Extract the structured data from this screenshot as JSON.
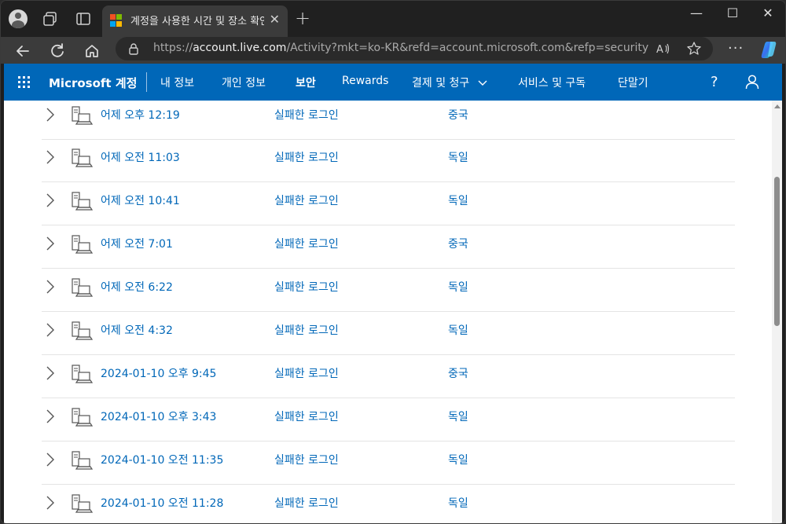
{
  "browser": {
    "tab": {
      "title": "계정을 사용한 시간 및 장소 확인",
      "favicon_colors": [
        "#f25022",
        "#7fba00",
        "#00a4ef",
        "#ffb900"
      ]
    },
    "new_tab_label": "+",
    "close_tab_label": "✕",
    "window_controls": {
      "minimize": "—",
      "maximize": "☐",
      "close": "✕"
    },
    "url": {
      "prefix": "https://",
      "host": "account.live.com",
      "path": "/Activity?mkt=ko-KR&refd=account.microsoft.com&refp=security"
    },
    "more_label": "···",
    "icons": [
      "profile-icon",
      "workspaces-icon",
      "tab-actions-icon",
      "back-icon",
      "refresh-icon",
      "home-icon",
      "lock-icon",
      "read-aloud-icon",
      "favorite-star-icon",
      "more-icon",
      "copilot-icon"
    ]
  },
  "ms_header": {
    "brand": "Microsoft 계정",
    "nav": [
      {
        "label": "내 정보",
        "active": false
      },
      {
        "label": "개인 정보",
        "active": false
      },
      {
        "label": "보안",
        "active": true
      },
      {
        "label": "Rewards",
        "active": false
      },
      {
        "label": "결제 및 청구",
        "active": false
      },
      {
        "label": "서비스 및 구독",
        "active": false
      },
      {
        "label": "단말기",
        "active": false
      }
    ],
    "accent_color": "#0067b8"
  },
  "activity": {
    "rows": [
      {
        "time": "어제 오후 12:19",
        "status": "실패한 로그인",
        "country": "중국"
      },
      {
        "time": "어제 오전 11:03",
        "status": "실패한 로그인",
        "country": "독일"
      },
      {
        "time": "어제 오전 10:41",
        "status": "실패한 로그인",
        "country": "독일"
      },
      {
        "time": "어제 오전 7:01",
        "status": "실패한 로그인",
        "country": "중국"
      },
      {
        "time": "어제 오전 6:22",
        "status": "실패한 로그인",
        "country": "독일"
      },
      {
        "time": "어제 오전 4:32",
        "status": "실패한 로그인",
        "country": "독일"
      },
      {
        "time": "2024-01-10 오후 9:45",
        "status": "실패한 로그인",
        "country": "중국"
      },
      {
        "time": "2024-01-10 오후 3:43",
        "status": "실패한 로그인",
        "country": "독일"
      },
      {
        "time": "2024-01-10 오전 11:35",
        "status": "실패한 로그인",
        "country": "독일"
      },
      {
        "time": "2024-01-10 오전 11:28",
        "status": "실패한 로그인",
        "country": "독일"
      }
    ]
  }
}
